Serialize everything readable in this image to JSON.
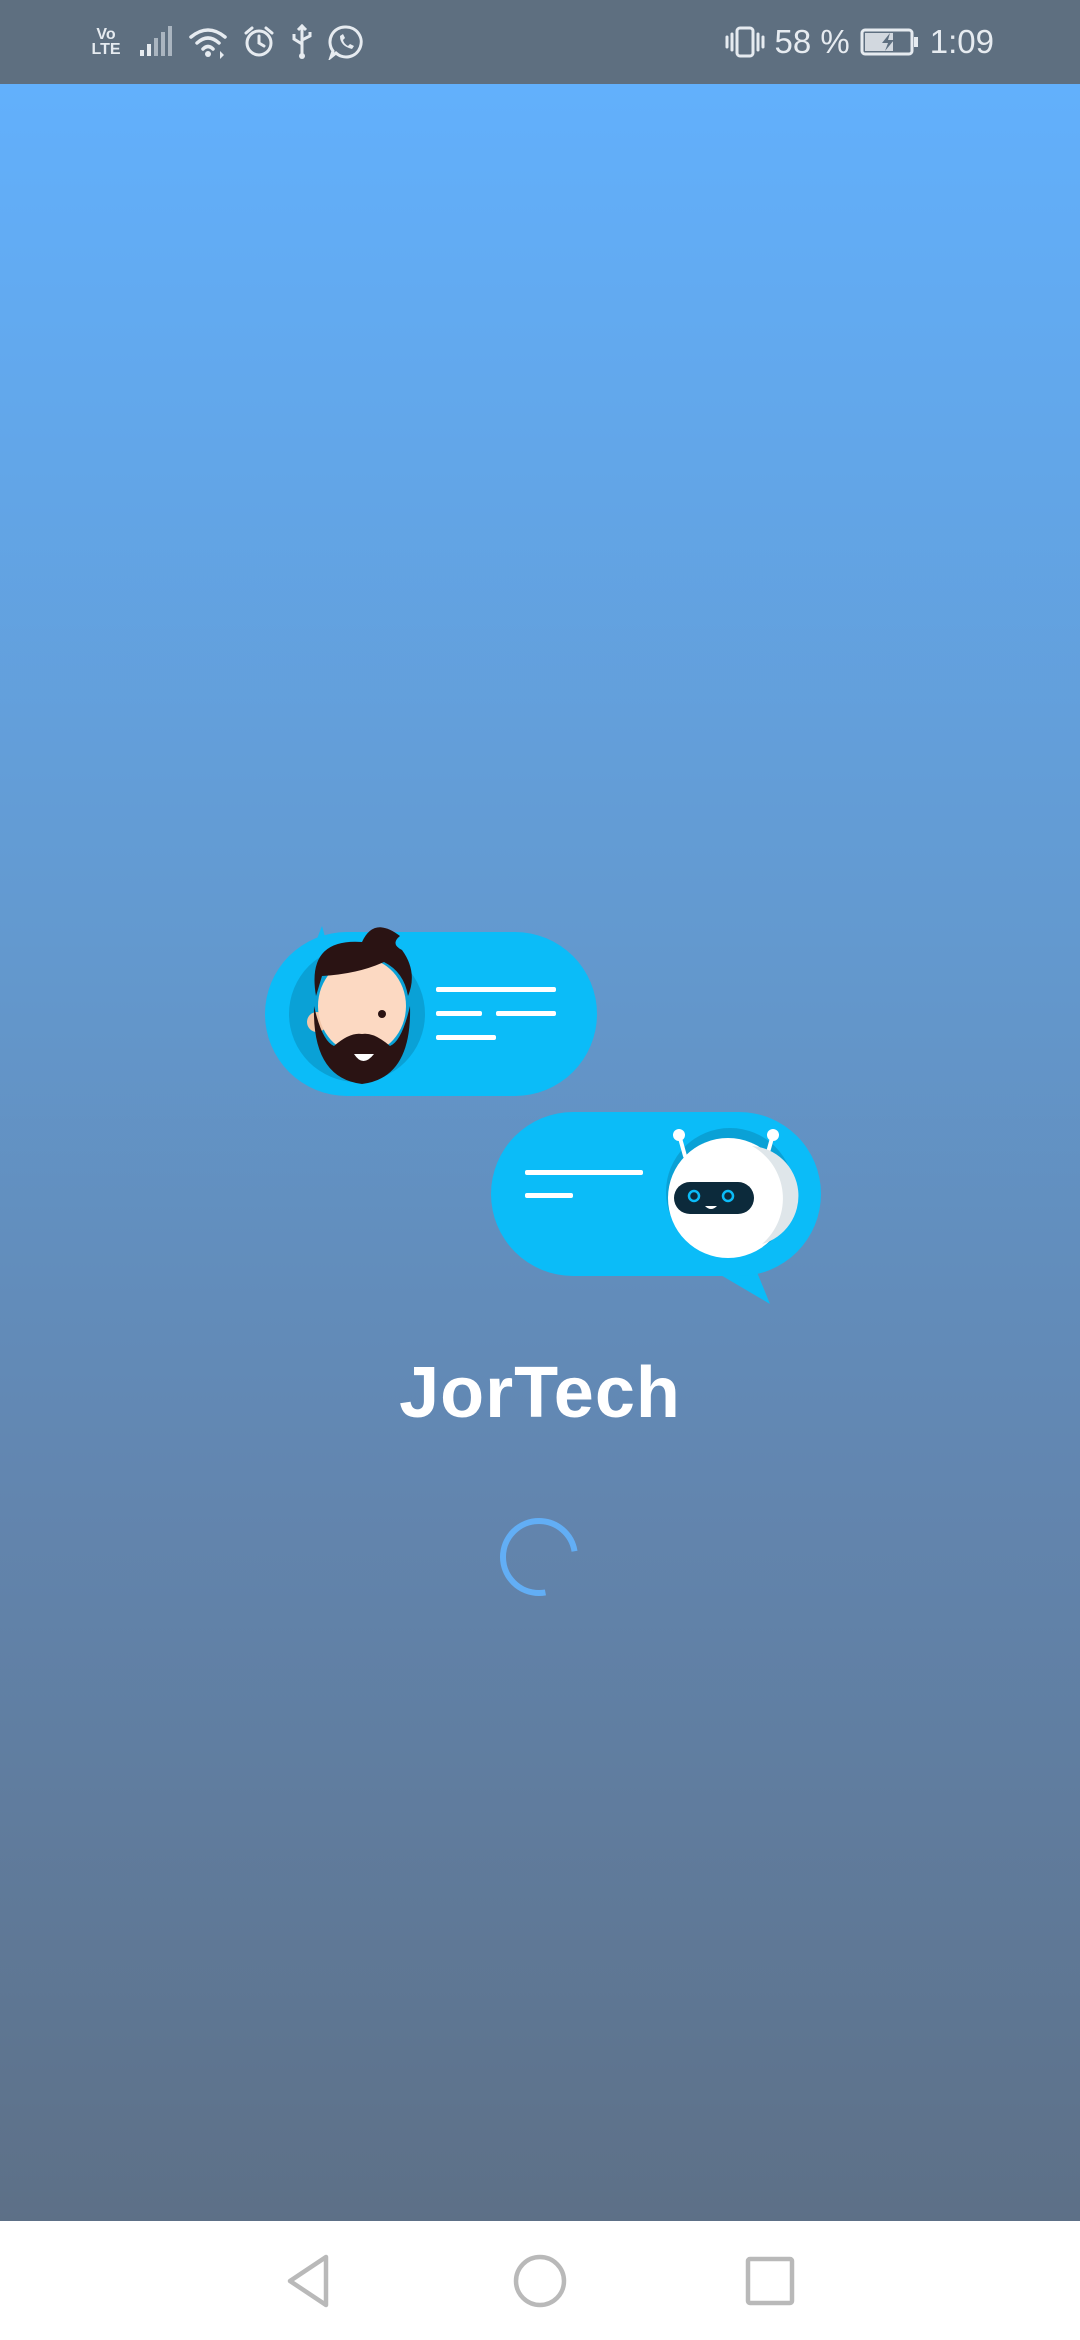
{
  "status_bar": {
    "network_label_top": "Vo",
    "network_label_bottom": "LTE",
    "battery_percent": "58 %",
    "time": "1:09",
    "icons": [
      "volte-icon",
      "signal-icon",
      "wifi-icon",
      "alarm-icon",
      "usb-icon",
      "whatsapp-icon",
      "vibrate-icon",
      "battery-charging-icon"
    ]
  },
  "splash": {
    "app_name": "JorTech",
    "loading": true
  },
  "colors": {
    "bubble": "#0bbcf8",
    "gradient_top": "#62b0fc",
    "gradient_bottom": "#5d7087",
    "status_bar": "#5e6f80",
    "spinner": "#62aef5"
  },
  "nav_bar": {
    "icons": [
      "back-icon",
      "home-icon",
      "recents-icon"
    ]
  }
}
